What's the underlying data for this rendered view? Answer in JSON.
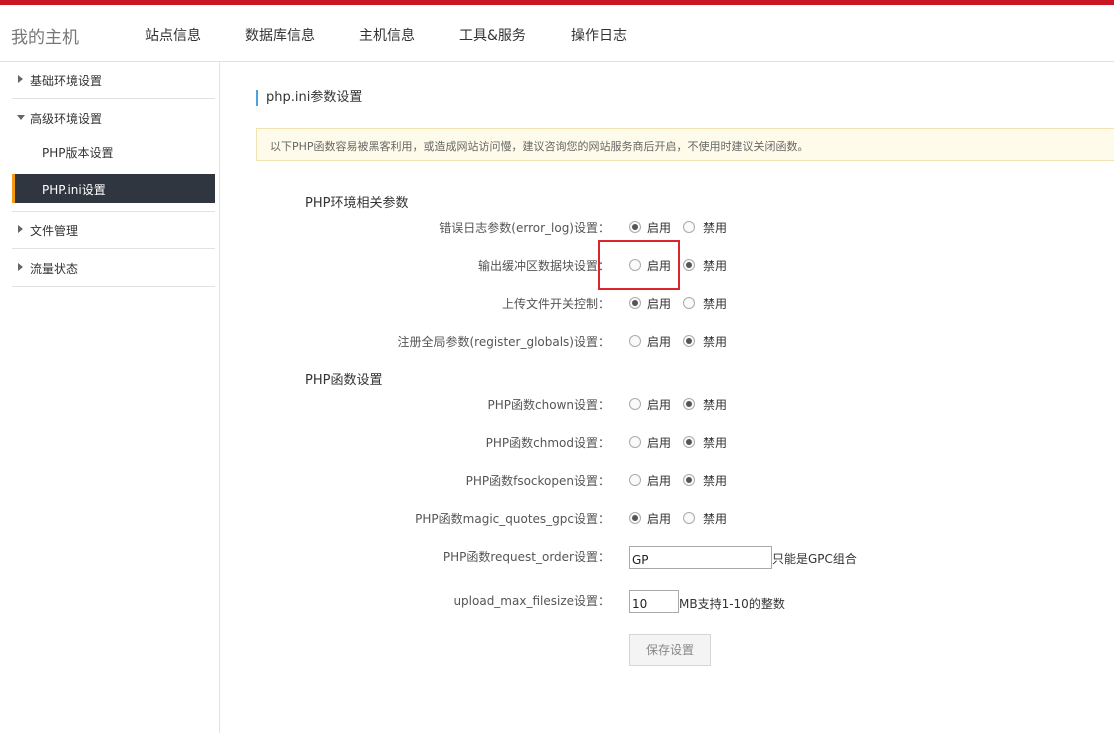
{
  "header": {
    "brand": "我的主机",
    "nav": [
      "站点信息",
      "数据库信息",
      "主机信息",
      "工具&服务",
      "操作日志"
    ]
  },
  "sidebar": {
    "groups": [
      {
        "label": "基础环境设置",
        "expanded": false
      },
      {
        "label": "高级环境设置",
        "expanded": true,
        "items": [
          "PHP版本设置",
          "PHP.ini设置"
        ],
        "active_item": "PHP.ini设置"
      },
      {
        "label": "文件管理",
        "expanded": false
      },
      {
        "label": "流量状态",
        "expanded": false
      }
    ]
  },
  "main": {
    "title": "php.ini参数设置",
    "notice": "以下PHP函数容易被黑客利用，或造成网站访问慢，建议咨询您的网站服务商后开启，不使用时建议关闭函数。",
    "options": {
      "enable": "启用",
      "disable": "禁用"
    },
    "env_section": {
      "title": "PHP环境相关参数",
      "rows": [
        {
          "label": "错误日志参数(error_log)设置：",
          "value": "启用"
        },
        {
          "label": "输出缓冲区数据块设置：",
          "value": "禁用"
        },
        {
          "label": "上传文件开关控制：",
          "value": "启用"
        },
        {
          "label": "注册全局参数(register_globals)设置：",
          "value": "禁用"
        }
      ]
    },
    "func_section": {
      "title": "PHP函数设置",
      "rows": [
        {
          "label": "PHP函数chown设置：",
          "value": "禁用"
        },
        {
          "label": "PHP函数chmod设置：",
          "value": "禁用"
        },
        {
          "label": "PHP函数fsockopen设置：",
          "value": "禁用"
        },
        {
          "label": "PHP函数magic_quotes_gpc设置：",
          "value": "启用"
        }
      ]
    },
    "request_order": {
      "label": "PHP函数request_order设置：",
      "value": "GP",
      "hint": "只能是GPC组合"
    },
    "upload_max": {
      "label": "upload_max_filesize设置：",
      "value": "10",
      "hint": "MB支持1-10的整数"
    },
    "save_label": "保存设置"
  },
  "colors": {
    "accent": "#c81623",
    "sidebar_active_bg": "#2f3640",
    "highlight_box": "#d9262c"
  }
}
